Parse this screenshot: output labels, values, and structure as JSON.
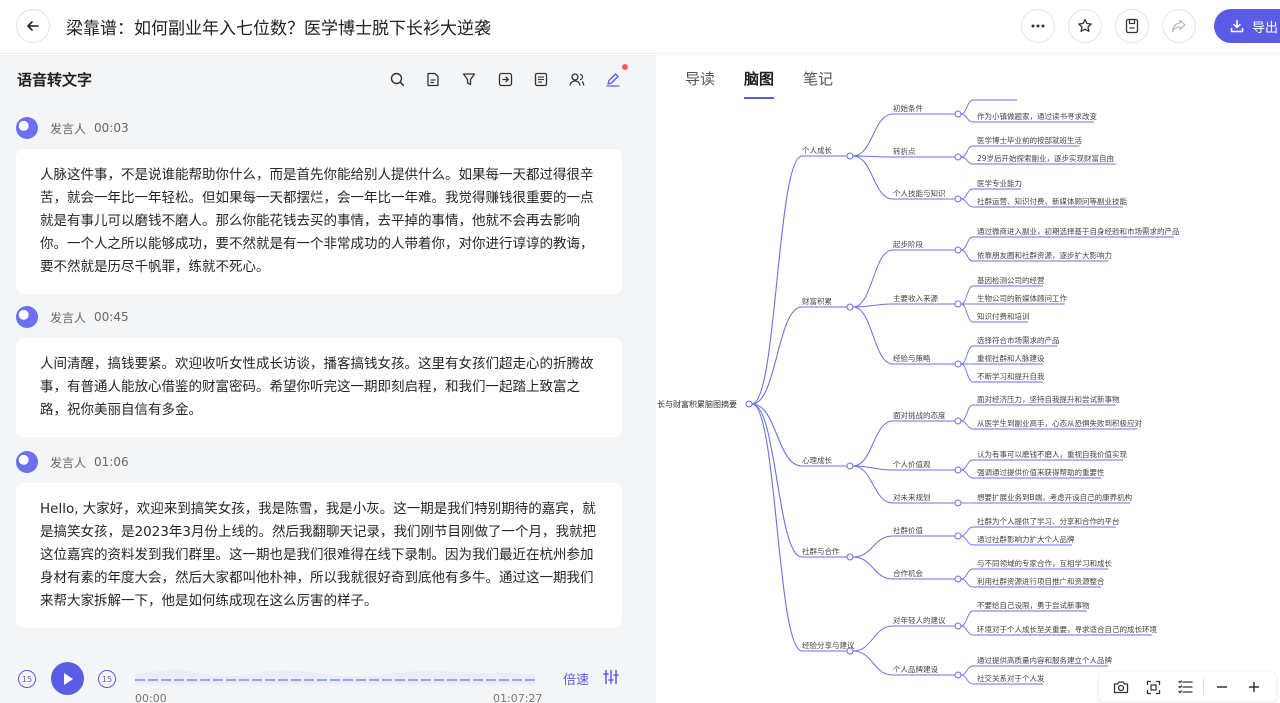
{
  "header": {
    "title": "梁靠谱：如何副业年入七位数？医学博士脱下长衫大逆袭",
    "export_label": "导出"
  },
  "transcript": {
    "title": "语音转文字",
    "segments": [
      {
        "speaker": "发言人",
        "time": "00:03",
        "text": "人脉这件事，不是说谁能帮助你什么，而是首先你能给别人提供什么。如果每一天都过得很辛苦，就会一年比一年轻松。但如果每一天都摆烂，会一年比一年难。我觉得赚钱很重要的一点就是有事儿可以磨钱不磨人。那么你能花钱去买的事情，去平掉的事情，他就不会再去影响你。一个人之所以能够成功，要不然就是有一个非常成功的人带着你，对你进行谆谆的教诲，要不然就是历尽千帆罪，练就不死心。"
      },
      {
        "speaker": "发言人",
        "time": "00:45",
        "text": "人间清醒，搞钱要紧。欢迎收听女性成长访谈，播客搞钱女孩。这里有女孩们超走心的折腾故事，有普通人能放心借鉴的财富密码。希望你听完这一期即刻启程，和我们一起踏上致富之路，祝你美丽自信有多金。"
      },
      {
        "speaker": "发言人",
        "time": "01:06",
        "text": "Hello, 大家好，欢迎来到搞笑女孩，我是陈雪，我是小灰。这一期是我们特别期待的嘉宾，就是搞笑女孩，是2023年3月份上线的。然后我翻聊天记录，我们刚节目刚做了一个月，我就把这位嘉宾的资料发到我们群里。这一期也是我们很难得在线下录制。因为我们最近在杭州参加身材有素的年度大会，然后大家都叫他朴神，所以我就很好奇到底他有多牛。通过这一期我们来帮大家拆解一下，他是如何练成现在这么厉害的样子。"
      }
    ]
  },
  "player": {
    "rewind_label": "15",
    "forward_label": "15",
    "current_time": "00:00",
    "total_time": "01:07:27",
    "speed_label": "倍速",
    "progress": 0
  },
  "right": {
    "tabs": [
      {
        "label": "导读",
        "active": false
      },
      {
        "label": "脑图",
        "active": true
      },
      {
        "label": "笔记",
        "active": false
      }
    ]
  },
  "mindmap": {
    "root": "长与财富积累脑图摘要",
    "branches": [
      {
        "label": "个人成长",
        "children": [
          {
            "label": "初始条件",
            "leaves": [
              "",
              "作为小镇做题家，通过读书寻求改变"
            ]
          },
          {
            "label": "转折点",
            "leaves": [
              "医学博士毕业前的按部就班生活",
              "29岁后开始探索副业，逐步实现财富自由"
            ]
          },
          {
            "label": "个人技能与知识",
            "leaves": [
              "医学专业能力",
              "社群运营、知识付费、新媒体顾问等副业技能"
            ]
          }
        ]
      },
      {
        "label": "财富积累",
        "children": [
          {
            "label": "起步阶段",
            "leaves": [
              "通过微商进入副业，初期选择基于自身经验和市场需求的产品",
              "依靠朋友圈和社群资源，逐步扩大影响力"
            ]
          },
          {
            "label": "主要收入来源",
            "leaves": [
              "基因检测公司的经营",
              "生物公司的新媒体顾问工作",
              "知识付费和培训"
            ]
          },
          {
            "label": "经验与策略",
            "leaves": [
              "选择符合市场需求的产品",
              "重视社群和人脉建设",
              "不断学习和提升自我"
            ]
          }
        ]
      },
      {
        "label": "心理成长",
        "children": [
          {
            "label": "面对挑战的态度",
            "leaves": [
              "面对经济压力，坚持自我提升和尝试新事物",
              "从医学生到副业高手，心态从恐惧失败到积极应对"
            ]
          },
          {
            "label": "个人价值观",
            "leaves": [
              "认为有事可以磨钱不磨人，重视自我价值实现",
              "强调通过提供价值来获得帮助的重要性"
            ]
          },
          {
            "label": "对未来规划",
            "leaves": [
              "想要扩展业务到B端，考虑开设自己的康养机构"
            ]
          }
        ]
      },
      {
        "label": "社群与合作",
        "children": [
          {
            "label": "社群价值",
            "leaves": [
              "社群为个人提供了学习、分享和合作的平台",
              "通过社群影响力扩大个人品牌"
            ]
          },
          {
            "label": "合作机会",
            "leaves": [
              "与不同领域的专家合作，互相学习和成长",
              "利用社群资源进行项目推广和资源整合"
            ]
          }
        ]
      },
      {
        "label": "经验分享与建议",
        "children": [
          {
            "label": "对年轻人的建议",
            "leaves": [
              "不要给自己设限，勇于尝试新事物",
              "环境对于个人成长至关重要，寻求适合自己的成长环境"
            ]
          },
          {
            "label": "个人品牌建设",
            "leaves": [
              "通过提供高质量内容和服务建立个人品牌",
              "社交关系对于个人发"
            ]
          }
        ]
      }
    ]
  },
  "colors": {
    "accent": "#5b5ce6",
    "panel_bg": "#f4f5f7",
    "line": "#6b6ee8"
  }
}
